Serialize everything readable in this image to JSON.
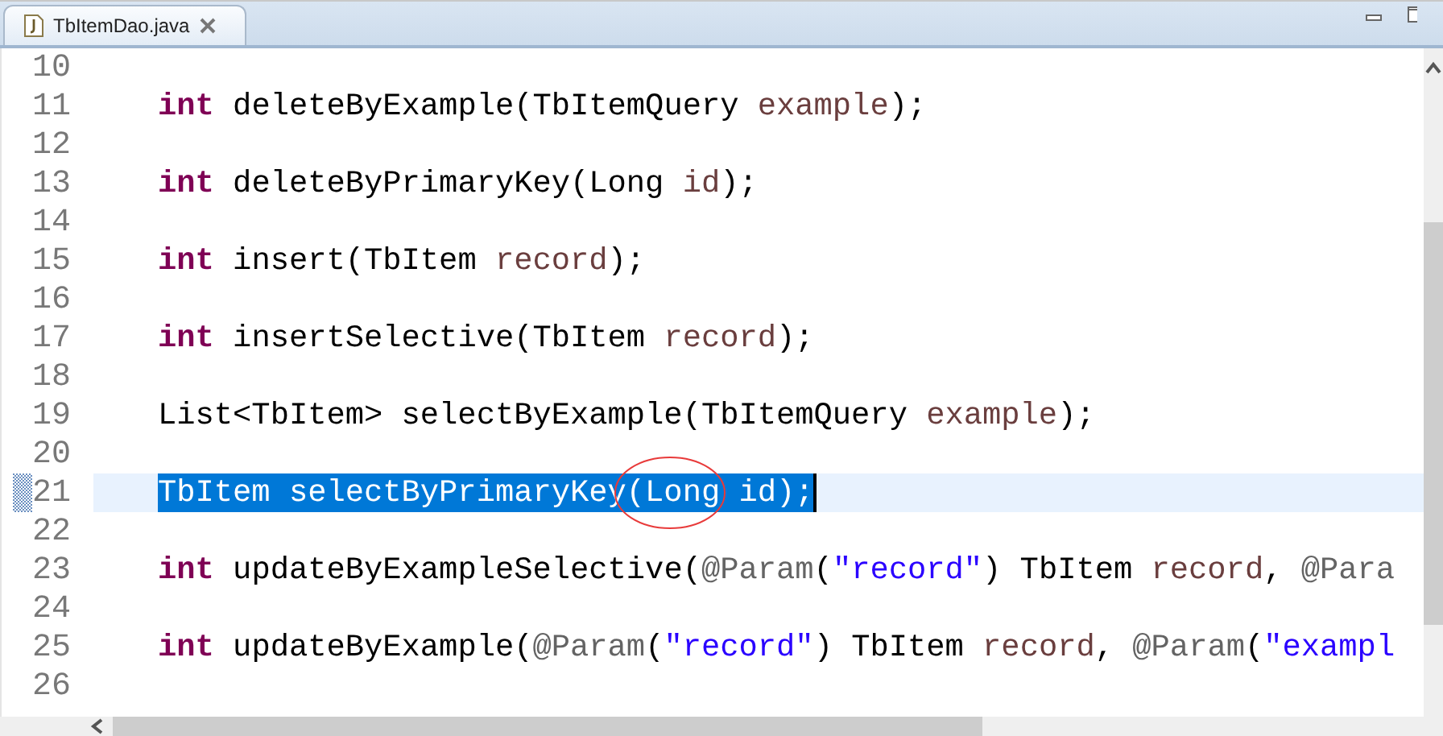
{
  "tabs": [
    {
      "label": "TbItemDao.java",
      "selected": true
    }
  ],
  "lines": [
    {
      "number": "10",
      "selected": false
    },
    {
      "number": "11",
      "selected": false,
      "tokens": [
        {
          "kind": "keyword",
          "text": "int"
        },
        {
          "kind": "plain",
          "text": " deleteByExample(TbItemQuery "
        },
        {
          "kind": "param",
          "text": "example"
        },
        {
          "kind": "plain",
          "text": ");"
        }
      ]
    },
    {
      "number": "12",
      "selected": false
    },
    {
      "number": "13",
      "selected": false,
      "tokens": [
        {
          "kind": "keyword",
          "text": "int"
        },
        {
          "kind": "plain",
          "text": " deleteByPrimaryKey(Long "
        },
        {
          "kind": "param",
          "text": "id"
        },
        {
          "kind": "plain",
          "text": ");"
        }
      ]
    },
    {
      "number": "14",
      "selected": false
    },
    {
      "number": "15",
      "selected": false,
      "tokens": [
        {
          "kind": "keyword",
          "text": "int"
        },
        {
          "kind": "plain",
          "text": " insert(TbItem "
        },
        {
          "kind": "param",
          "text": "record"
        },
        {
          "kind": "plain",
          "text": ");"
        }
      ]
    },
    {
      "number": "16",
      "selected": false
    },
    {
      "number": "17",
      "selected": false,
      "tokens": [
        {
          "kind": "keyword",
          "text": "int"
        },
        {
          "kind": "plain",
          "text": " insertSelective(TbItem "
        },
        {
          "kind": "param",
          "text": "record"
        },
        {
          "kind": "plain",
          "text": ");"
        }
      ]
    },
    {
      "number": "18",
      "selected": false
    },
    {
      "number": "19",
      "selected": false,
      "tokens": [
        {
          "kind": "plain",
          "text": "List<TbItem> selectByExample(TbItemQuery "
        },
        {
          "kind": "param",
          "text": "example"
        },
        {
          "kind": "plain",
          "text": ");"
        }
      ]
    },
    {
      "number": "20",
      "selected": false
    },
    {
      "number": "21",
      "selected": true,
      "tokens": [
        {
          "kind": "plain",
          "text": "TbItem selectByPrimaryKey(Long "
        },
        {
          "kind": "param",
          "text": "id"
        },
        {
          "kind": "plain",
          "text": ");"
        }
      ]
    },
    {
      "number": "22",
      "selected": false
    },
    {
      "number": "23",
      "selected": false,
      "tokens": [
        {
          "kind": "keyword",
          "text": "int"
        },
        {
          "kind": "plain",
          "text": " updateByExampleSelective("
        },
        {
          "kind": "annotation",
          "text": "@Param"
        },
        {
          "kind": "plain",
          "text": "("
        },
        {
          "kind": "string",
          "text": "\"record\""
        },
        {
          "kind": "plain",
          "text": ") TbItem "
        },
        {
          "kind": "param",
          "text": "record"
        },
        {
          "kind": "plain",
          "text": ", "
        },
        {
          "kind": "annotation",
          "text": "@Para"
        }
      ]
    },
    {
      "number": "24",
      "selected": false
    },
    {
      "number": "25",
      "selected": false,
      "tokens": [
        {
          "kind": "keyword",
          "text": "int"
        },
        {
          "kind": "plain",
          "text": " updateByExample("
        },
        {
          "kind": "annotation",
          "text": "@Param"
        },
        {
          "kind": "plain",
          "text": "("
        },
        {
          "kind": "string",
          "text": "\"record\""
        },
        {
          "kind": "plain",
          "text": ") TbItem "
        },
        {
          "kind": "param",
          "text": "record"
        },
        {
          "kind": "plain",
          "text": ", "
        },
        {
          "kind": "annotation",
          "text": "@Param"
        },
        {
          "kind": "plain",
          "text": "("
        },
        {
          "kind": "string",
          "text": "\"exampl"
        }
      ]
    },
    {
      "number": "26",
      "selected": false
    }
  ]
}
